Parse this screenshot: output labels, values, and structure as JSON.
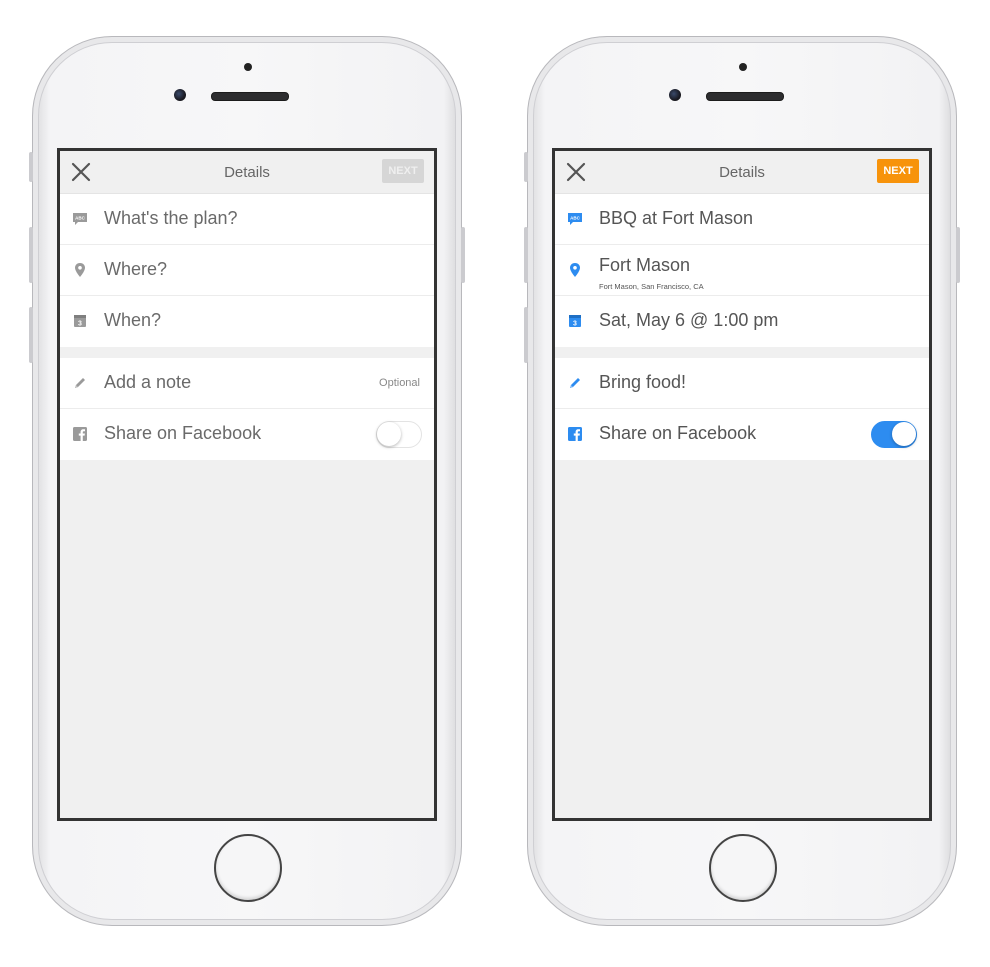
{
  "colors": {
    "accent_blue": "#2d8cf0",
    "next_orange": "#f7930b",
    "icon_gray": "#9a9a9a"
  },
  "left": {
    "title": "Details",
    "next_label": "NEXT",
    "plan_placeholder": "What's the plan?",
    "where_placeholder": "Where?",
    "when_placeholder": "When?",
    "note_placeholder": "Add a note",
    "note_hint": "Optional",
    "facebook_label": "Share on Facebook",
    "facebook_toggle": "off"
  },
  "right": {
    "title": "Details",
    "next_label": "NEXT",
    "plan_value": "BBQ at Fort Mason",
    "where_value": "Fort Mason",
    "where_subtitle": "Fort Mason, San Francisco, CA",
    "when_value": "Sat, May 6 @ 1:00 pm",
    "note_value": "Bring food!",
    "facebook_label": "Share on Facebook",
    "facebook_toggle": "on"
  },
  "icons": {
    "close": "close-icon",
    "plan": "abc-speech-bubble-icon",
    "where": "map-pin-icon",
    "when": "calendar-icon",
    "note": "pencil-icon",
    "facebook": "facebook-icon"
  }
}
